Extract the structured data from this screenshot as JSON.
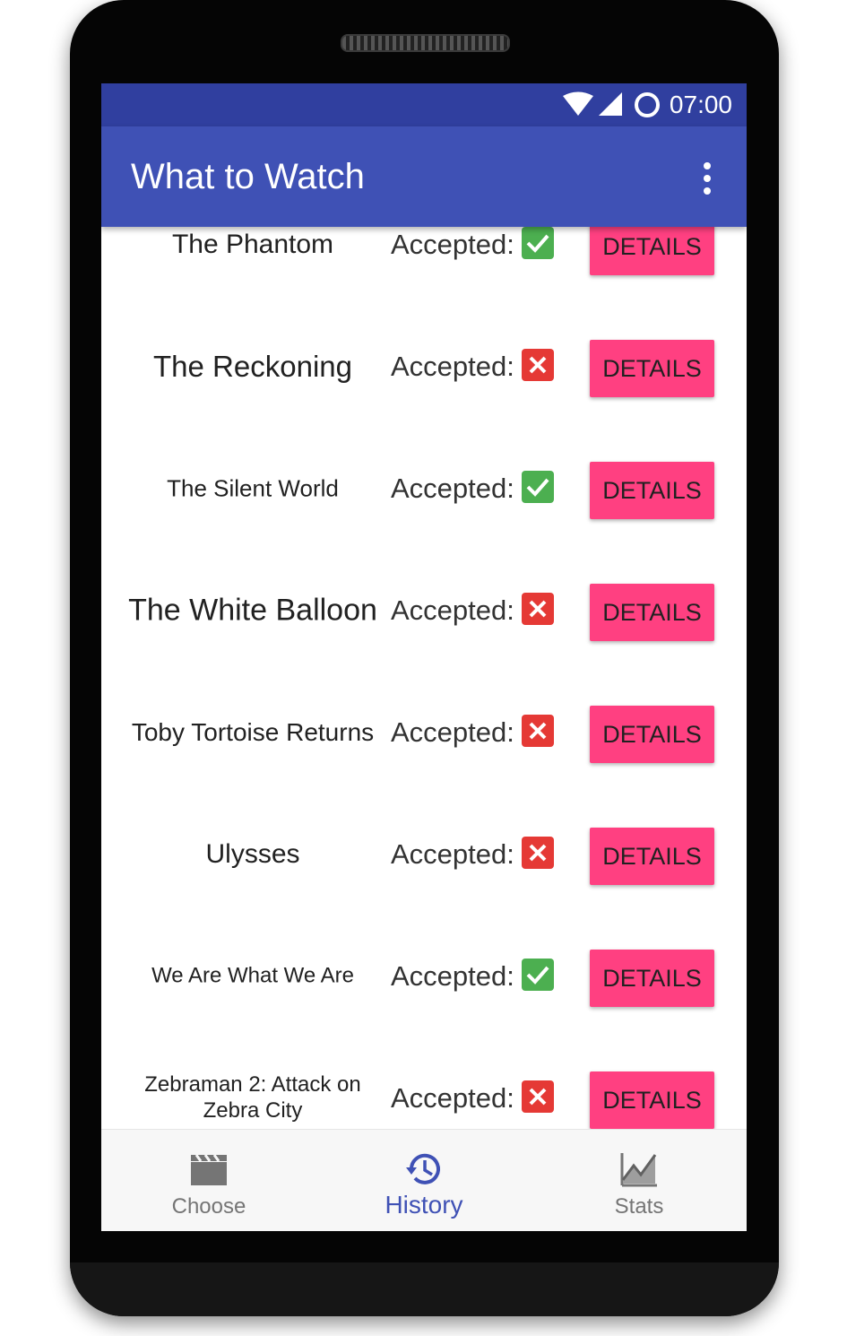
{
  "status_bar": {
    "time": "07:00"
  },
  "app_bar": {
    "title": "What to Watch",
    "menu_icon": "more-vert-icon"
  },
  "colors": {
    "status_bar": "#303f9f",
    "app_bar": "#3f51b5",
    "accent": "#ff4081",
    "accepted_true": "#4caf50",
    "accepted_false": "#e53935"
  },
  "movies": [
    {
      "title": "The Phantom",
      "accepted_label": "Accepted:",
      "accepted": true,
      "details_label": "DETAILS"
    },
    {
      "title": "The Reckoning",
      "accepted_label": "Accepted:",
      "accepted": false,
      "details_label": "DETAILS"
    },
    {
      "title": "The Silent World",
      "accepted_label": "Accepted:",
      "accepted": true,
      "details_label": "DETAILS"
    },
    {
      "title": "The White Balloon",
      "accepted_label": "Accepted:",
      "accepted": false,
      "details_label": "DETAILS"
    },
    {
      "title": "Toby Tortoise Returns",
      "accepted_label": "Accepted:",
      "accepted": false,
      "details_label": "DETAILS"
    },
    {
      "title": "Ulysses",
      "accepted_label": "Accepted:",
      "accepted": false,
      "details_label": "DETAILS"
    },
    {
      "title": "We Are What We Are",
      "accepted_label": "Accepted:",
      "accepted": true,
      "details_label": "DETAILS"
    },
    {
      "title": "Zebraman 2: Attack on Zebra City",
      "accepted_label": "Accepted:",
      "accepted": false,
      "details_label": "DETAILS"
    }
  ],
  "bottom_nav": {
    "items": [
      {
        "label": "Choose",
        "icon": "clapperboard-icon",
        "active": false
      },
      {
        "label": "History",
        "icon": "history-icon",
        "active": true
      },
      {
        "label": "Stats",
        "icon": "chart-icon",
        "active": false
      }
    ]
  }
}
